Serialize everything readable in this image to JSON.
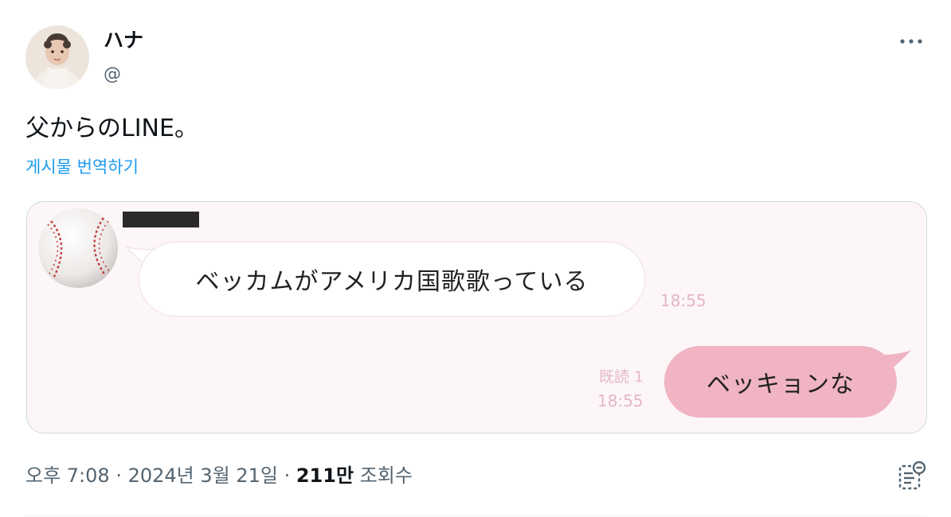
{
  "author": {
    "display_name": "ハナ",
    "handle": "@"
  },
  "tweet": {
    "text": "父からのLINE。",
    "translate_label": "게시물 번역하기"
  },
  "chat": {
    "incoming_message": "ベッカムがアメリカ国歌歌っている",
    "incoming_time": "18:55",
    "outgoing_message": "ベッキョンな",
    "read_status": "既読 1",
    "outgoing_time": "18:55",
    "incoming_bubble_color": "#ffffff",
    "outgoing_bubble_color": "#f0b4c2"
  },
  "meta": {
    "time": "오후 7:08",
    "separator": " · ",
    "date": "2024년 3월 21일",
    "views_count": "211만",
    "views_label": "조회수"
  },
  "icons": {
    "more": "more-horizontal-icon",
    "analytics": "bookmark-stats-icon"
  },
  "colors": {
    "link": "#1d9bf0",
    "secondary_text": "#536471",
    "primary_text": "#0f1419"
  }
}
